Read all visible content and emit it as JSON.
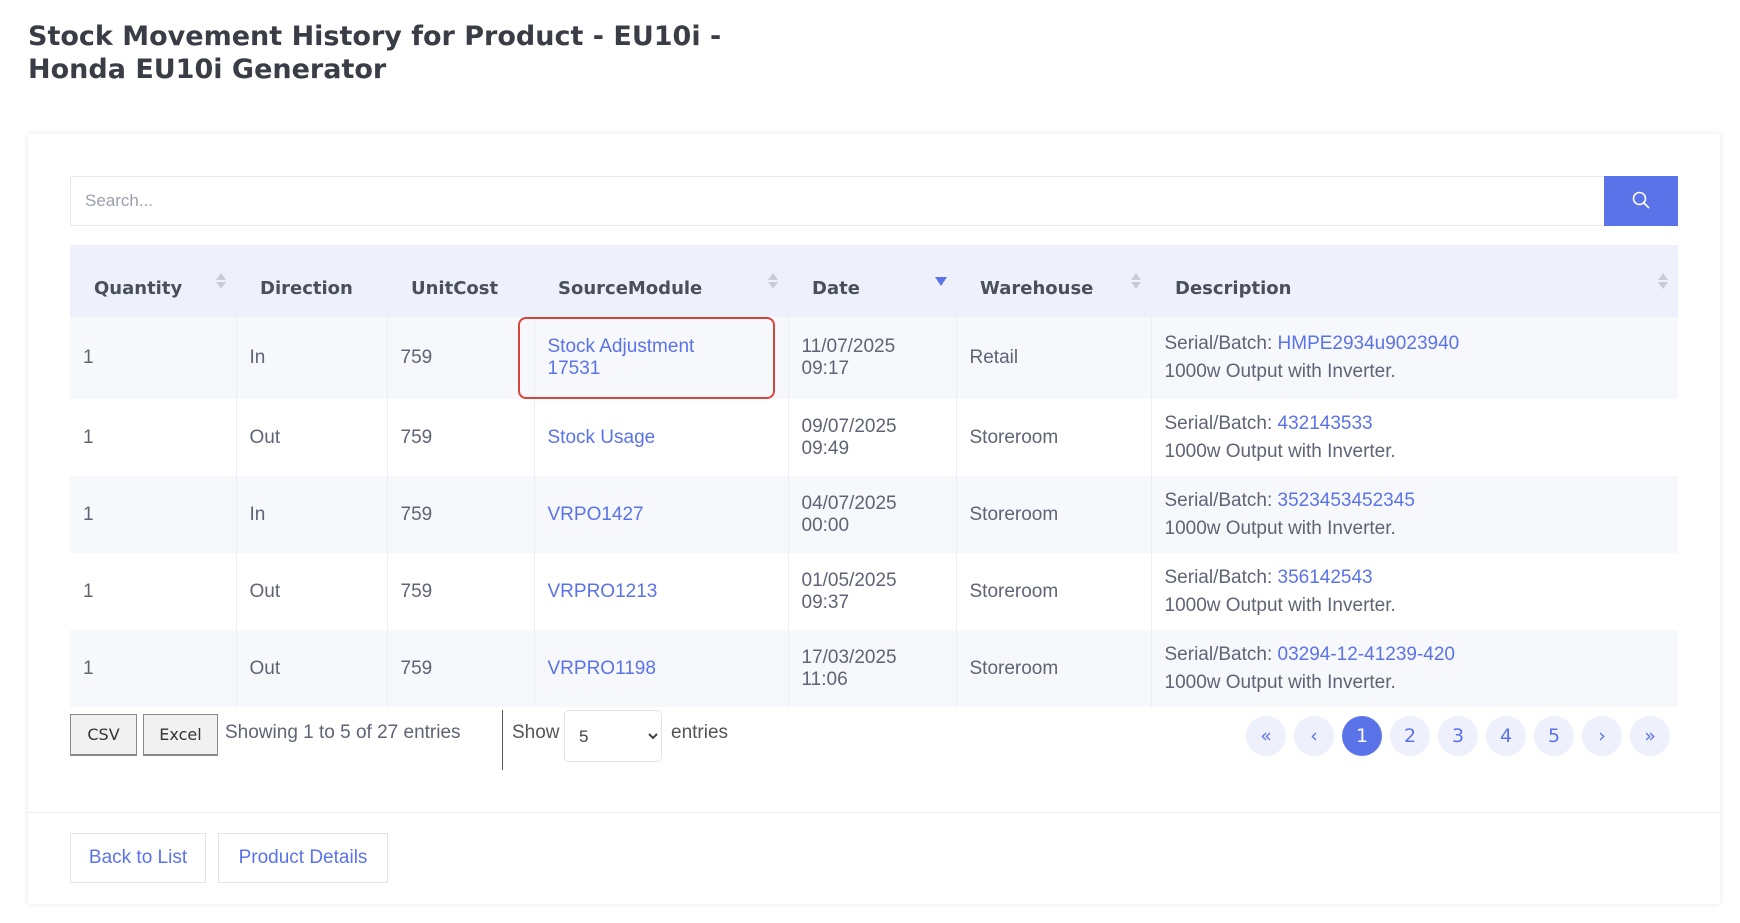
{
  "page": {
    "title": "Stock Movement History for Product - EU10i - Honda EU10i Generator"
  },
  "search": {
    "placeholder": "Search...",
    "icon": "search-icon"
  },
  "table": {
    "columns": [
      {
        "label": "Quantity",
        "sort": "none"
      },
      {
        "label": "Direction",
        "sort": "disabled"
      },
      {
        "label": "UnitCost",
        "sort": "disabled"
      },
      {
        "label": "SourceModule",
        "sort": "none"
      },
      {
        "label": "Date",
        "sort": "desc"
      },
      {
        "label": "Warehouse",
        "sort": "none"
      },
      {
        "label": "Description",
        "sort": "none"
      }
    ],
    "rows": [
      {
        "quantity": "1",
        "direction": "In",
        "unit_cost": "759",
        "source_module": "Stock Adjustment 17531",
        "date": "11/07/2025 09:17",
        "warehouse": "Retail",
        "serial_label": "Serial/Batch:",
        "serial": "HMPE2934u9023940",
        "description": "1000w Output with Inverter.",
        "highlighted": true
      },
      {
        "quantity": "1",
        "direction": "Out",
        "unit_cost": "759",
        "source_module": "Stock Usage",
        "date": "09/07/2025 09:49",
        "warehouse": "Storeroom",
        "serial_label": "Serial/Batch:",
        "serial": "432143533",
        "description": "1000w Output with Inverter.",
        "highlighted": false
      },
      {
        "quantity": "1",
        "direction": "In",
        "unit_cost": "759",
        "source_module": "VRPO1427",
        "date": "04/07/2025 00:00",
        "warehouse": "Storeroom",
        "serial_label": "Serial/Batch:",
        "serial": "3523453452345",
        "description": "1000w Output with Inverter.",
        "highlighted": false
      },
      {
        "quantity": "1",
        "direction": "Out",
        "unit_cost": "759",
        "source_module": "VRPRO1213",
        "date": "01/05/2025 09:37",
        "warehouse": "Storeroom",
        "serial_label": "Serial/Batch:",
        "serial": "356142543",
        "description": "1000w Output with Inverter.",
        "highlighted": false
      },
      {
        "quantity": "1",
        "direction": "Out",
        "unit_cost": "759",
        "source_module": "VRPRO1198",
        "date": "17/03/2025 11:06",
        "warehouse": "Storeroom",
        "serial_label": "Serial/Batch:",
        "serial": "03294-12-41239-420",
        "description": "1000w Output with Inverter.",
        "highlighted": false
      }
    ]
  },
  "toolbar": {
    "csv_label": "CSV",
    "excel_label": "Excel",
    "entries_info": "Showing 1 to 5 of 27 entries",
    "show_label": "Show",
    "page_size": "5",
    "entries_label": "entries"
  },
  "pagination": {
    "first": "«",
    "prev": "‹",
    "pages": [
      "1",
      "2",
      "3",
      "4",
      "5"
    ],
    "current": "1",
    "next": "›",
    "last": "»"
  },
  "footer": {
    "back_label": "Back to List",
    "details_label": "Product Details"
  },
  "colors": {
    "accent": "#5b73e8",
    "header_bg": "#eef0fb",
    "highlight_border": "#d9453d"
  }
}
